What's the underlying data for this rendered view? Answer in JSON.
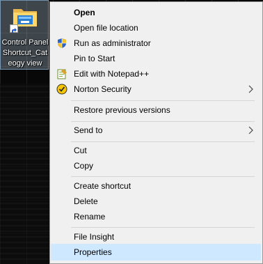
{
  "desktop": {
    "icon": {
      "name": "folder-shortcut-icon",
      "label_lines": [
        "Control Panel",
        "Shortcut_Cat",
        "eogy view"
      ]
    }
  },
  "context_menu": {
    "items": [
      {
        "label": "Open",
        "bold": true
      },
      {
        "label": "Open file location"
      },
      {
        "label": "Run as administrator",
        "icon": "uac-shield-icon"
      },
      {
        "label": "Pin to Start"
      },
      {
        "label": "Edit with Notepad++",
        "icon": "notepad-plus-plus-icon"
      },
      {
        "label": "Norton Security",
        "icon": "norton-icon",
        "submenu": true
      },
      {
        "label": "Restore previous versions"
      },
      {
        "label": "Send to",
        "submenu": true
      },
      {
        "label": "Cut"
      },
      {
        "label": "Copy"
      },
      {
        "label": "Create shortcut"
      },
      {
        "label": "Delete"
      },
      {
        "label": "Rename"
      },
      {
        "label": "File Insight"
      },
      {
        "label": "Properties",
        "highlighted": true
      }
    ]
  },
  "colors": {
    "menu_background": "#f0f0f0",
    "menu_border": "#979797",
    "highlight": "#cde8ff",
    "separator": "#d5d5d5",
    "selection_overlay": "#cce8ff"
  }
}
